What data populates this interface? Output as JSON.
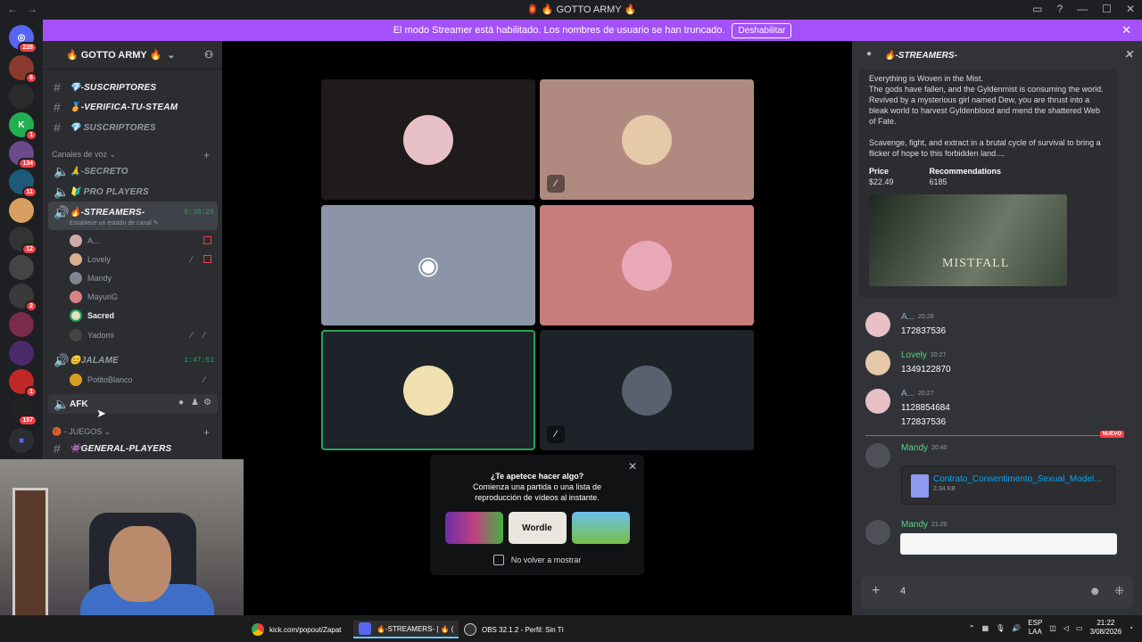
{
  "window": {
    "title": "🏮 🔥 GOTTO ARMY 🔥",
    "back": "←",
    "forward": "→",
    "minimize": "—",
    "maximize": "☐",
    "close": "✕"
  },
  "server_rail": {
    "badges": [
      "228",
      "6",
      "1",
      "134",
      "11",
      "12",
      "2",
      "1",
      "157"
    ]
  },
  "banner": {
    "text": "El modo Streamer está habilitado. Los nombres de usuario se han truncado.",
    "button": "Deshabilitar"
  },
  "sidebar": {
    "server_name": "🔥 GOTTO ARMY 🔥",
    "channels_top": [
      "💎-SUSCRIPTORES",
      "🏅-VERIFICA-TU-STEAM",
      "💎 SUSCRIPTORES"
    ],
    "voice_category": "Canales de voz",
    "voice_channels": [
      "🙏-SECRETO",
      "🔰 PRO PLAYERS"
    ],
    "streamers_channel": {
      "name": "🔥-STREAMERS-",
      "timer": "5:38:25",
      "status": "Establece un estado de canal"
    },
    "members": [
      "A...",
      "Lovely",
      "Mandy",
      "MayuriG",
      "Sacred",
      "Yadomi"
    ],
    "jalame": {
      "name": "😊JALAME",
      "timer": "1:47:51",
      "member": "PotitoBlanco"
    },
    "afk": "AFK",
    "games_category": "🏀 - JUEGOS",
    "games_channel": "👾GENERAL-PLAYERS"
  },
  "activity": {
    "line1": "¿Te apetece hacer algo?",
    "line2": "Comienza una partida o una lista de",
    "line3": "reproducción de vídeos al instante.",
    "wordle": "Wordle",
    "checkbox": "No volver a mostrar"
  },
  "chat": {
    "channel": "🔥-STREAMERS-",
    "embed": {
      "desc1": "Everything is Woven in the Mist.",
      "desc2": "The gods have fallen, and the Gyldenmist is consuming the world. Revived by a mysterious girl named Dew, you are thrust into a bleak world to harvest Gyldenblood and mend the shattered Web of Fate.",
      "desc3": "Scavenge, fight, and extract in a brutal cycle of survival to bring a flicker of hope to this forbidden land....",
      "price_label": "Price",
      "price": "$22.49",
      "rec_label": "Recommendations",
      "rec": "6185",
      "image_text": "MISTFALL"
    },
    "messages": [
      {
        "author": "A...",
        "time": "20:26",
        "lines": [
          "172837536"
        ]
      },
      {
        "author": "Lovely",
        "time": "20:27",
        "lines": [
          "1349122870"
        ]
      },
      {
        "author": "A...",
        "time": "20:27",
        "lines": [
          "1128854684",
          "172837536"
        ]
      },
      {
        "author": "Mandy",
        "time": "20:40",
        "lines": []
      },
      {
        "author": "Mandy",
        "time": "21:20",
        "lines": []
      }
    ],
    "new_label": "NUEVO",
    "file": {
      "name": "Contrato_Consentimento_Sexual_Model...",
      "size": "2.34 KB"
    },
    "input_value": "4"
  },
  "taskbar": {
    "items": [
      "kick.com/popout/Zapat",
      "🔥-STREAMERS- | 🔥 (",
      "OBS 32.1.2 - Perfil: Sin Tí"
    ],
    "lang": "ESP",
    "lang2": "LAA",
    "time": "21:22",
    "date": "3/08/2026"
  },
  "colors": {
    "banner": "#a451f9",
    "accent": "#23a55a",
    "unread": "#f23f43"
  }
}
